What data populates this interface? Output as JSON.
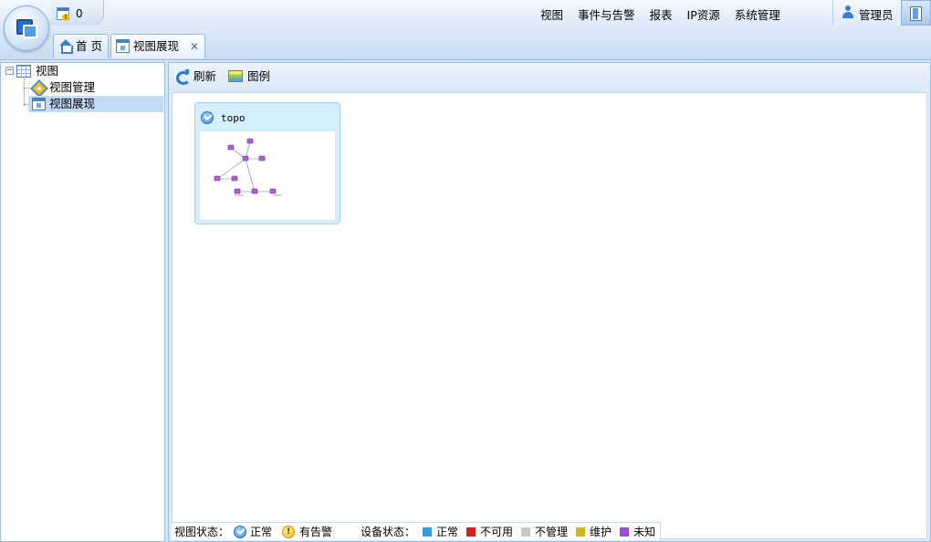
{
  "header": {
    "notice_count": "0",
    "nav": [
      "视图",
      "事件与告警",
      "报表",
      "IP资源",
      "系统管理"
    ],
    "user_name": "管理员"
  },
  "tabs": [
    {
      "label": "首 页",
      "icon": "home-icon"
    },
    {
      "label": "视图展现",
      "icon": "view-icon",
      "closable": true
    }
  ],
  "tab_close_glyph": "✕",
  "sidebar": {
    "root": "视图",
    "items": [
      {
        "label": "视图管理",
        "icon": "gear-diamond-icon"
      },
      {
        "label": "视图展现",
        "icon": "view-icon",
        "selected": true
      }
    ]
  },
  "toolbar": {
    "refresh": "刷新",
    "legend": "图例"
  },
  "views": [
    {
      "title": "topo",
      "status": "normal"
    }
  ],
  "statusbar": {
    "view_status_label": "视图状态：",
    "view_normal": "正常",
    "view_alarm": "有告警",
    "device_status_label": "设备状态：",
    "devices": [
      {
        "label": "正常",
        "color": "#2e9ee0"
      },
      {
        "label": "不可用",
        "color": "#d42020"
      },
      {
        "label": "不管理",
        "color": "#c8c8c8"
      },
      {
        "label": "维护",
        "color": "#d3b31b"
      },
      {
        "label": "未知",
        "color": "#9a4fd6"
      }
    ]
  },
  "colors": {
    "accent": "#2b79cf",
    "selected": "#c4dbf7"
  }
}
